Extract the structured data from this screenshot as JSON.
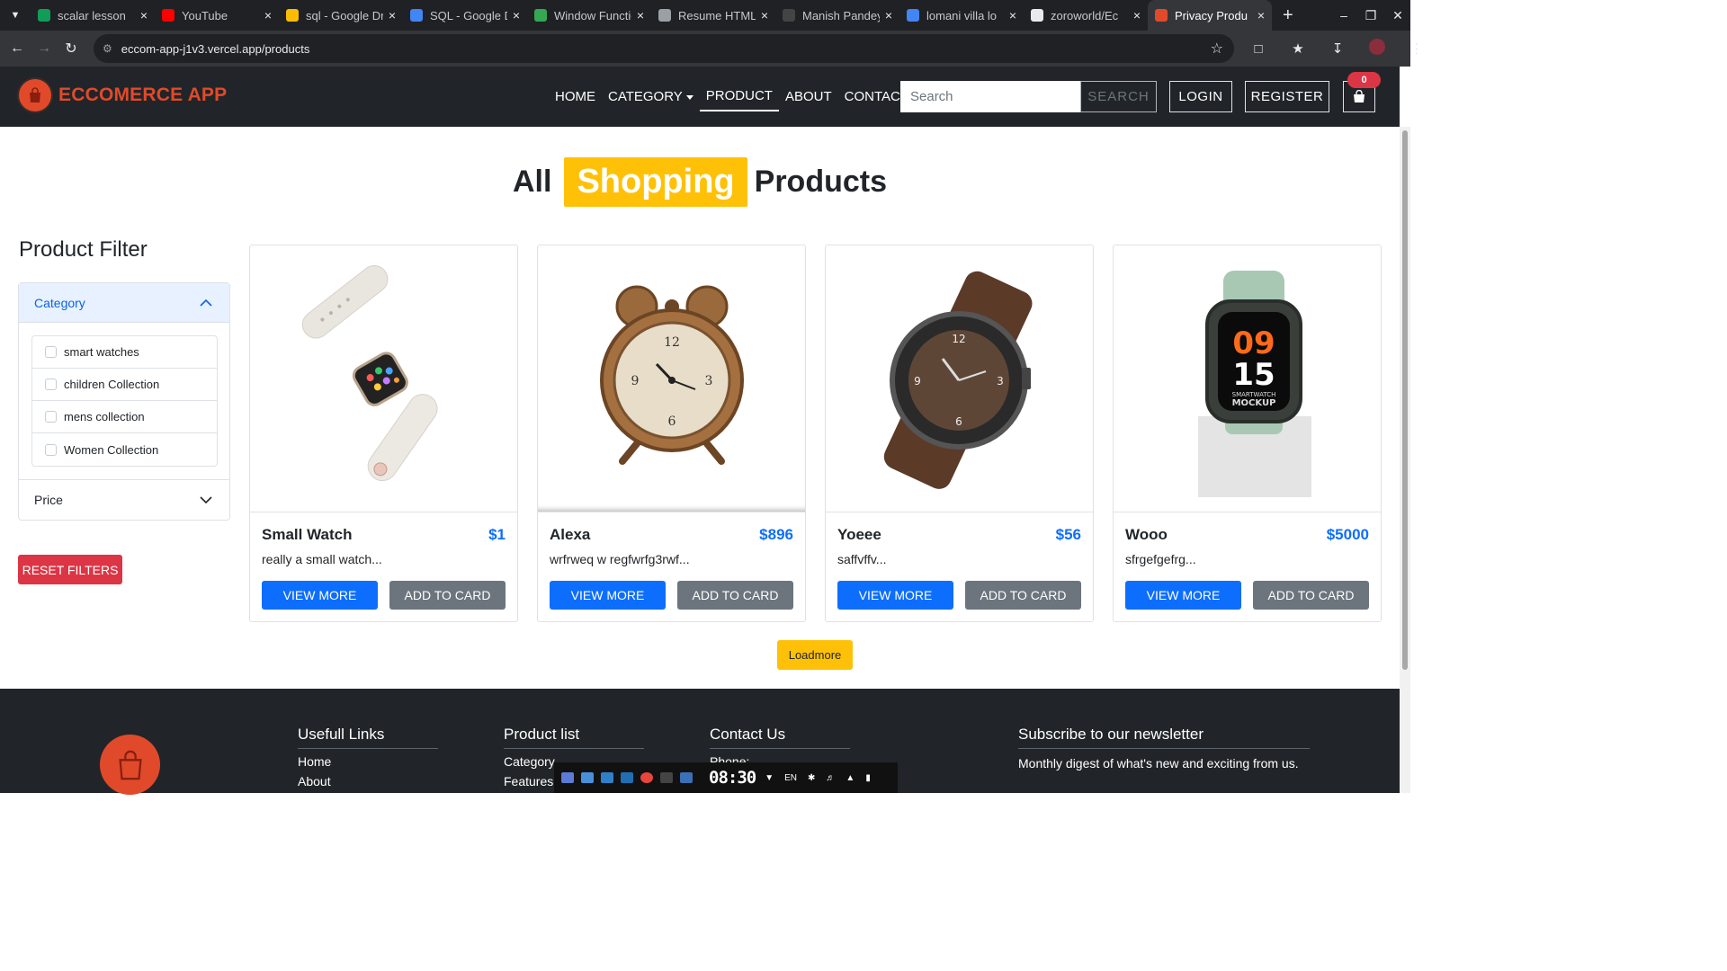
{
  "browser": {
    "tabs": [
      {
        "label": "scalar lesson",
        "icon": "sheets-icon",
        "color": "#0f9d58"
      },
      {
        "label": "YouTube",
        "icon": "youtube-icon",
        "color": "#ff0000"
      },
      {
        "label": "sql - Google Drive",
        "icon": "drive-icon",
        "color": "#fbbc04"
      },
      {
        "label": "SQL - Google Docs",
        "icon": "docs-icon",
        "color": "#4285f4"
      },
      {
        "label": "Window Functions",
        "icon": "link-icon",
        "color": "#34a853"
      },
      {
        "label": "Resume HTML",
        "icon": "openai-icon",
        "color": "#9aa0a6"
      },
      {
        "label": "Manish Pandey",
        "icon": "github-icon",
        "color": "#444"
      },
      {
        "label": "lomani villa lo",
        "icon": "google-icon",
        "color": "#4285f4"
      },
      {
        "label": "zoroworld/Ec",
        "icon": "github-icon",
        "color": "#e8eaed"
      },
      {
        "label": "Privacy Produ",
        "icon": "site-icon",
        "color": "#e04a2a"
      }
    ],
    "url": "eccom-app-j1v3.vercel.app/products"
  },
  "header": {
    "logo_text": "ECCOMERCE APP",
    "nav": {
      "home": "HOME",
      "category": "CATEGORY",
      "product": "PRODUCT",
      "about": "ABOUT",
      "contact": "CONTACT"
    },
    "search_placeholder": "Search",
    "search_button": "SEARCH",
    "login": "LOGIN",
    "register": "REGISTER",
    "cart_count": "0"
  },
  "hero": {
    "pre": "All",
    "highlight": "Shopping",
    "post": "Products"
  },
  "filters": {
    "title": "Product Filter",
    "category_label": "Category",
    "categories": [
      "smart watches",
      "children Collection",
      "mens collection",
      "Women Collection"
    ],
    "price_label": "Price",
    "reset": "RESET FILTERS"
  },
  "products": [
    {
      "name": "Small Watch",
      "price": "$1",
      "desc": "really a small watch...",
      "view": "VIEW MORE",
      "add": "ADD TO CARD"
    },
    {
      "name": "Alexa",
      "price": "$896",
      "desc": "wrfrweq w regfwrfg3rwf...",
      "view": "VIEW MORE",
      "add": "ADD TO CARD"
    },
    {
      "name": "Yoeee",
      "price": "$56",
      "desc": "saffvffv...",
      "view": "VIEW MORE",
      "add": "ADD TO CARD"
    },
    {
      "name": "Wooo",
      "price": "$5000",
      "desc": "sfrgefgefrg...",
      "view": "VIEW MORE",
      "add": "ADD TO CARD"
    }
  ],
  "loadmore": "Loadmore",
  "footer": {
    "useful": {
      "title": "Usefull Links",
      "links": [
        "Home",
        "About"
      ]
    },
    "product_list": {
      "title": "Product list",
      "links": [
        "Category",
        "Features"
      ]
    },
    "contact": {
      "title": "Contact Us",
      "links": [
        "Phone:"
      ]
    },
    "newsletter": {
      "title": "Subscribe to our newsletter",
      "text": "Monthly digest of what's new and exciting from us."
    }
  },
  "taskbar": {
    "clock": "08:30",
    "lang": "EN"
  },
  "watch_face": {
    "hour": "09",
    "minute": "15",
    "label1": "SMARTWATCH",
    "label2": "MOCKUP"
  }
}
